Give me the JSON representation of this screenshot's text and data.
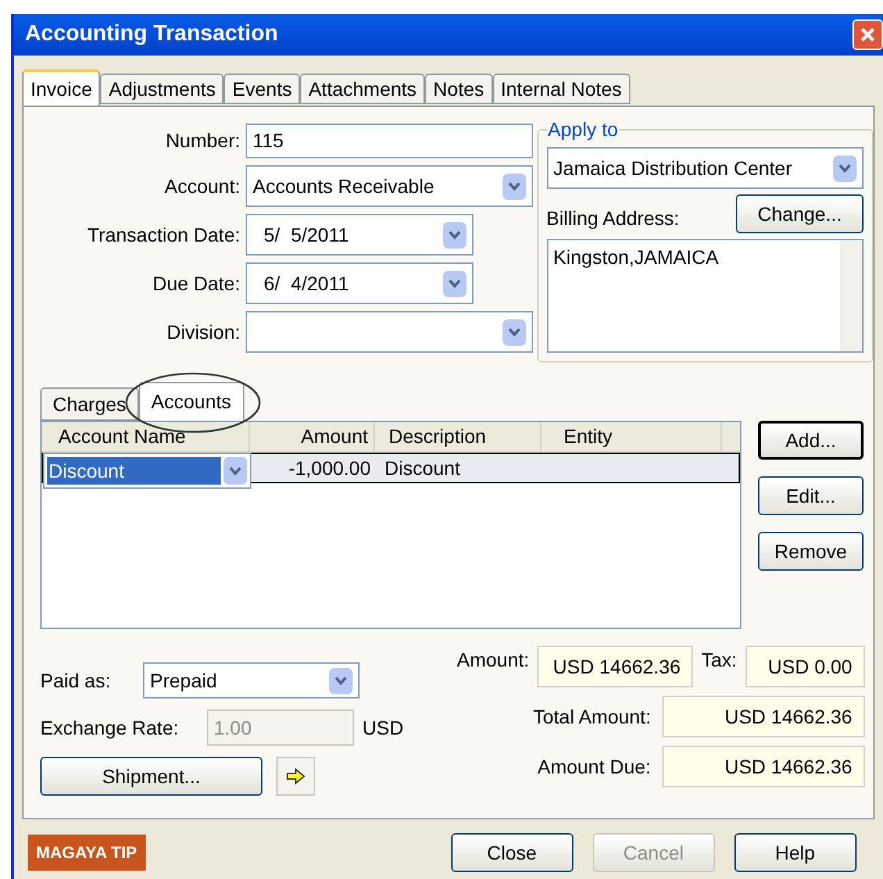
{
  "window": {
    "title": "Accounting Transaction"
  },
  "tabs": [
    {
      "label": "Invoice",
      "selected": true
    },
    {
      "label": "Adjustments",
      "selected": false
    },
    {
      "label": "Events",
      "selected": false
    },
    {
      "label": "Attachments",
      "selected": false
    },
    {
      "label": "Notes",
      "selected": false
    },
    {
      "label": "Internal Notes",
      "selected": false
    }
  ],
  "fields": [
    {
      "label": "Number:",
      "value": "115",
      "kind": "text"
    },
    {
      "label": "Account:",
      "value": "Accounts Receivable",
      "kind": "combo"
    },
    {
      "label": "Transaction Date:",
      "value": "5/  5/2011",
      "kind": "date"
    },
    {
      "label": "Due Date:",
      "value": "6/  4/2011",
      "kind": "date"
    },
    {
      "label": "Division:",
      "kind": "combo"
    }
  ],
  "apply_to": {
    "legend": "Apply to",
    "value": "Jamaica Distribution Center",
    "change_button": "Change...",
    "billing_label": "Billing Address:",
    "billing_address": "Kingston,JAMAICA"
  },
  "sub_tabs": [
    {
      "label": "Charges",
      "selected": false
    },
    {
      "label": "Accounts",
      "selected": true
    }
  ],
  "table": {
    "columns": [
      "Account Name",
      "Amount",
      "Description",
      "Entity"
    ],
    "rows": [
      {
        "account_name": "Discount",
        "amount": "-1,000.00",
        "description": "Discount",
        "selected": true
      }
    ]
  },
  "side_buttons": [
    {
      "label": "Add...",
      "default": true
    },
    {
      "label": "Edit...",
      "default": false
    },
    {
      "label": "Remove",
      "default": false
    }
  ],
  "payment": {
    "paid_as_label": "Paid as:",
    "paid_as": "Prepaid",
    "exchange_label": "Exchange Rate:",
    "exchange_rate": "1.00",
    "exchange_disabled": true,
    "currency": "USD",
    "shipment_button": "Shipment..."
  },
  "totals": {
    "amount_label": "Amount:",
    "amount": "USD 14662.36",
    "tax_label": "Tax:",
    "tax": "USD 0.00",
    "total_label": "Total Amount:",
    "total": "USD 14662.36",
    "due_label": "Amount Due:",
    "due": "USD 14662.36"
  },
  "footer": {
    "tip": "MAGAYA TIP",
    "buttons": [
      {
        "label": "Close",
        "disabled": false
      },
      {
        "label": "Cancel",
        "disabled": true
      },
      {
        "label": "Help",
        "disabled": false
      }
    ]
  }
}
